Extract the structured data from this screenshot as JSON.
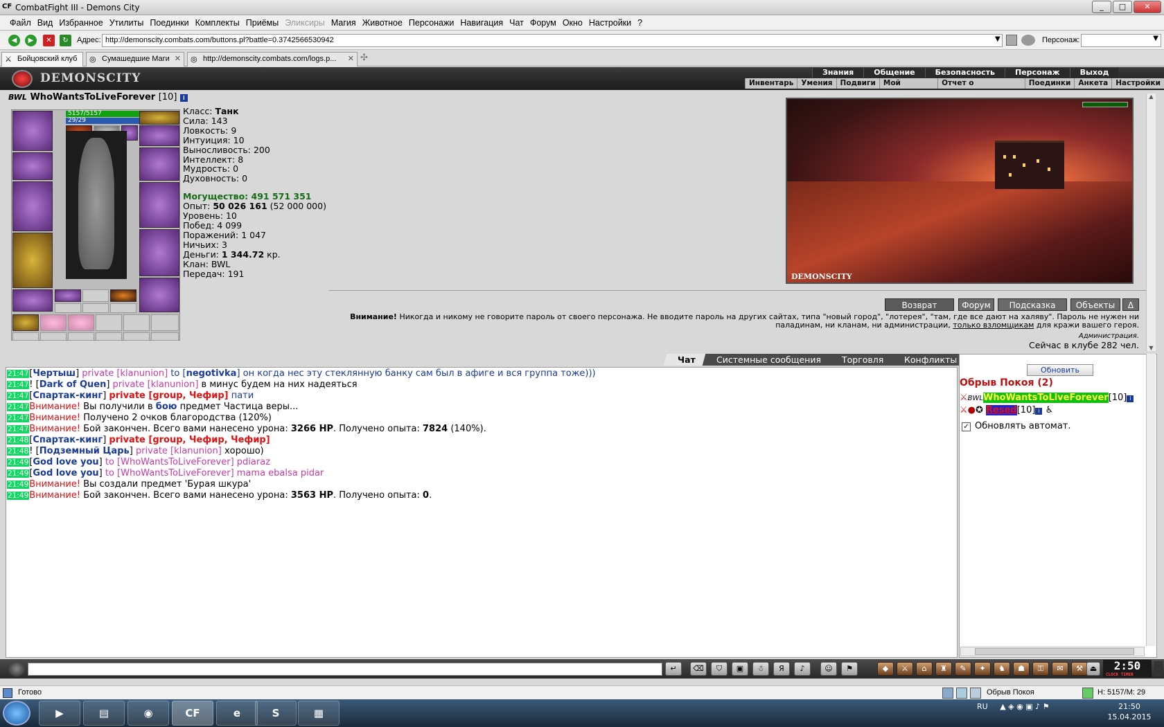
{
  "window": {
    "title": "CombatFight III - Demons City",
    "app_icon": "CF"
  },
  "menu": [
    "Файл",
    "Вид",
    "Избранное",
    "Утилиты",
    "Поединки",
    "Комплекты",
    "Приёмы",
    "Эликсиры",
    "Магия",
    "Животное",
    "Персонажи",
    "Навигация",
    "Чат",
    "Форум",
    "Окно",
    "Настройки",
    "?"
  ],
  "menu_disabled": "Эликсиры",
  "address": {
    "label": "Адрес:",
    "url": "http://demonscity.combats.com/buttons.pl?battle=0.3742566530942",
    "char_label": "Персонаж:"
  },
  "tabs": [
    {
      "label": "Бойцовский клуб",
      "active": true
    },
    {
      "label": "Сумашедшие Маги",
      "active": false
    },
    {
      "label": "http://demonscity.combats.com/logs.p...",
      "active": false
    }
  ],
  "game": {
    "logo": "DEMONSCITY",
    "top_menu": [
      "Знания",
      "Общение",
      "Безопасность",
      "Персонаж",
      "Выход"
    ],
    "sub_menu": [
      "Инвентарь",
      "Умения",
      "Подвиги",
      "Мой Скролл",
      "Отчет о переводах",
      "Поединки",
      "Анкета",
      "Настройки"
    ]
  },
  "character": {
    "clan_tag": "BWL",
    "name": "WhoWantsToLiveForever",
    "level": "[10]",
    "hp": "5157/5157",
    "mana": "29/29",
    "stats": [
      {
        "label": "Класс: ",
        "value": "Танк",
        "bold": true
      },
      {
        "label": "Сила: ",
        "value": "143"
      },
      {
        "label": "Ловкость: ",
        "value": "9"
      },
      {
        "label": "Интуиция: ",
        "value": "10"
      },
      {
        "label": "Выносливость: ",
        "value": "200"
      },
      {
        "label": "Интеллект: ",
        "value": "8"
      },
      {
        "label": "Мудрость: ",
        "value": "0"
      },
      {
        "label": "Духовность: ",
        "value": "0"
      }
    ],
    "power": "Могущество: 491 571 351",
    "stats2": [
      {
        "label": "Опыт: ",
        "value": "50 026 161",
        "extra": " (52 000 000)",
        "bold": true
      },
      {
        "label": "Уровень: ",
        "value": "10"
      },
      {
        "label": "Побед: ",
        "value": "4 099"
      },
      {
        "label": "Поражений: ",
        "value": "1 047"
      },
      {
        "label": "Ничьих: ",
        "value": "3"
      },
      {
        "label": "Деньги: ",
        "value": "1 344.72",
        "extra": " кр.",
        "bold": true
      },
      {
        "label": "Клан: ",
        "value": "BWL"
      },
      {
        "label": "Передач: ",
        "value": "191"
      }
    ]
  },
  "location": {
    "caption": "DEMONSCITY"
  },
  "actions": [
    "Возврат",
    "Форум",
    "Подсказка",
    "Объекты",
    "Δ"
  ],
  "warning": {
    "bold": "Внимание!",
    "text1": " Никогда и никому не говорите пароль от своего персонажа. Не вводите пароль на других сайтах, типа \"новый город\", \"лотерея\", \"там, где все дают на халяву\". Пароль не нужен ни",
    "text2": "паладинам, ни кланам, ни администрации, ",
    "link": "только взломщикам",
    "text3": " для кражи вашего героя.",
    "signature": "Администрация."
  },
  "online": "Сейчас в клубе 282 чел.",
  "chat_tabs": [
    "Чат",
    "Системные сообщения",
    "Торговля",
    "Конфликты"
  ],
  "chat": [
    {
      "t": "21:47",
      "parts": [
        [
          "",
          "["
        ],
        [
          "nick",
          "Чертыш"
        ],
        [
          "",
          "] "
        ],
        [
          "priv",
          "private [klanunion]"
        ],
        [
          "to",
          " to ["
        ],
        [
          "nick",
          "negotivka"
        ],
        [
          "to",
          "] он когда нес эту стеклянную банку сам был в афиге и вся группа тоже)))"
        ]
      ]
    },
    {
      "t": "21:47",
      "parts": [
        [
          "",
          "! ["
        ],
        [
          "nick",
          "Dark of Quen"
        ],
        [
          "",
          "] "
        ],
        [
          "priv",
          "private [klanunion]"
        ],
        [
          "",
          " в минус будем на них надеяться"
        ]
      ]
    },
    {
      "t": "21:47",
      "parts": [
        [
          "",
          "["
        ],
        [
          "nick",
          "Спартак-кинг"
        ],
        [
          "",
          "] "
        ],
        [
          "grp",
          "private [group, Чефир]"
        ],
        [
          "blue",
          " пати"
        ]
      ]
    },
    {
      "t": "21:47",
      "parts": [
        [
          "red",
          "Внимание!"
        ],
        [
          "",
          " Вы получили в "
        ],
        [
          "nick",
          "бою"
        ],
        [
          "",
          " предмет Частица веры..."
        ]
      ]
    },
    {
      "t": "21:47",
      "parts": [
        [
          "red",
          "Внимание!"
        ],
        [
          "",
          " Получено 2 очков благородства (120%)"
        ]
      ]
    },
    {
      "t": "21:47",
      "parts": [
        [
          "red",
          "Внимание!"
        ],
        [
          "",
          " Бой закончен. Всего вами нанесено урона: "
        ],
        [
          "b",
          "3266 HP"
        ],
        [
          "",
          ". Получено опыта: "
        ],
        [
          "b",
          "7824"
        ],
        [
          "",
          " (140%)."
        ]
      ]
    },
    {
      "t": "21:48",
      "parts": [
        [
          "",
          "["
        ],
        [
          "nick",
          "Спартак-кинг"
        ],
        [
          "",
          "] "
        ],
        [
          "grp",
          "private [group, Чефир, Чефир]"
        ]
      ]
    },
    {
      "t": "21:48",
      "parts": [
        [
          "",
          "! ["
        ],
        [
          "nick",
          "Подземный Царь"
        ],
        [
          "",
          "] "
        ],
        [
          "priv",
          "private [klanunion]"
        ],
        [
          "",
          " хорошо)"
        ]
      ]
    },
    {
      "t": "21:49",
      "parts": [
        [
          "",
          "["
        ],
        [
          "nick",
          "God love you"
        ],
        [
          "",
          "] "
        ],
        [
          "priv",
          "to [WhoWantsToLiveForever]"
        ],
        [
          "pinkmsg",
          " pdiaraz"
        ]
      ]
    },
    {
      "t": "21:49",
      "parts": [
        [
          "",
          "["
        ],
        [
          "nick",
          "God love you"
        ],
        [
          "",
          "] "
        ],
        [
          "priv",
          "to [WhoWantsToLiveForever]"
        ],
        [
          "pinkmsg",
          " mama ebalsa pidar"
        ]
      ]
    },
    {
      "t": "21:49",
      "parts": [
        [
          "red",
          "Внимание!"
        ],
        [
          "",
          " Вы создали предмет 'Бурая шкура'"
        ]
      ]
    },
    {
      "t": "21:49",
      "parts": [
        [
          "red",
          "Внимание!"
        ],
        [
          "",
          " Бой закончен. Всего вами нанесено урона: "
        ],
        [
          "b",
          "3563 HP"
        ],
        [
          "",
          ". Получено опыта: "
        ],
        [
          "b",
          "0"
        ],
        [
          "",
          "."
        ]
      ]
    }
  ],
  "room": {
    "refresh": "Обновить",
    "title": "Обрыв Покоя (2)",
    "players": [
      {
        "clan": "BWL",
        "name": "WhoWantsToLiveForever",
        "level": "[10]",
        "style": "green"
      },
      {
        "clan": "",
        "name": "Resed",
        "level": "[10]",
        "style": "red"
      }
    ],
    "auto_update": "Обновлять автомат."
  },
  "clock": {
    "time": "2:50",
    "labels": "CLOCK TIMER"
  },
  "status": {
    "text": "Готово",
    "location": "Обрыв Покоя",
    "hm": "H: 5157/M: 29"
  },
  "taskbar": {
    "lang": "RU",
    "time": "21:50",
    "date": "15.04.2015"
  }
}
